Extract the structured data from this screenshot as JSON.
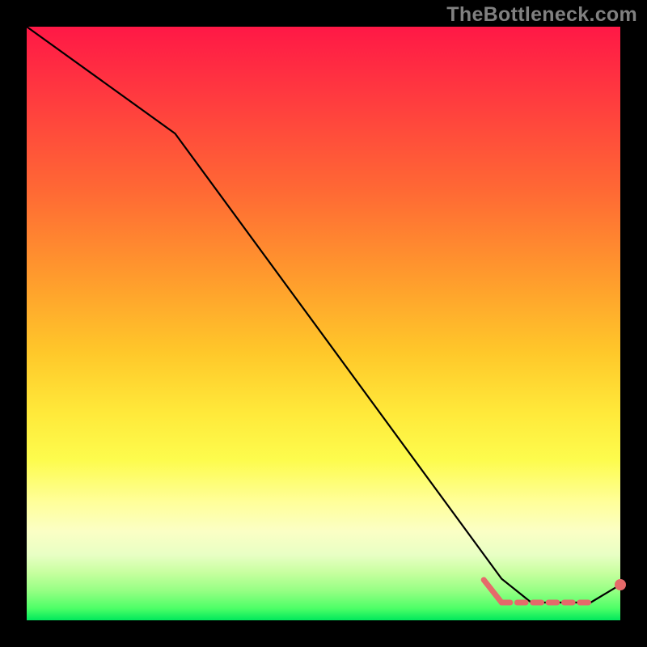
{
  "watermark": "TheBottleneck.com",
  "colors": {
    "background": "#000000",
    "watermark": "#808080",
    "curve": "#000000",
    "marker": "#e56a6a"
  },
  "chart_data": {
    "type": "line",
    "x": [
      0.0,
      0.25,
      0.8,
      0.85,
      0.95,
      1.0
    ],
    "values": [
      1.0,
      0.82,
      0.07,
      0.03,
      0.03,
      0.06
    ],
    "title": "",
    "xlabel": "",
    "ylabel": "",
    "xlim": [
      0,
      1
    ],
    "ylim": [
      0,
      1
    ],
    "grid": false,
    "annotations": {
      "highlight_dashes": {
        "x_start": 0.8,
        "x_end": 0.95,
        "y": 0.03,
        "count": 6
      },
      "end_dot": {
        "x": 1.0,
        "y": 0.06
      }
    },
    "note": "Axis values are normalized to [0,1]; chart has no visible tick labels or legend."
  }
}
